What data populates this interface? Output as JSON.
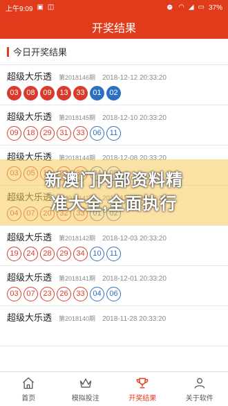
{
  "status_bar": {
    "time": "上午9:09",
    "battery": "37%"
  },
  "header": {
    "title": "开奖结果"
  },
  "section": {
    "title": "今日开奖结果"
  },
  "draws": [
    {
      "name": "超级大乐透",
      "issue": "第2018146期",
      "time": "2018-12-12 20:33:20",
      "red": [
        "03",
        "08",
        "09",
        "13",
        "33"
      ],
      "blue": [
        "01",
        "02"
      ],
      "style": "solid"
    },
    {
      "name": "超级大乐透",
      "issue": "第2018145期",
      "time": "2018-12-10 20:33:20",
      "red": [
        "09",
        "18",
        "29",
        "31",
        "33"
      ],
      "blue": [
        "06",
        "11"
      ],
      "style": "outline"
    },
    {
      "name": "超级大乐透",
      "issue": "第2018144期",
      "time": "2018-12-08 20:33:20",
      "red": [
        "03",
        "05",
        "19",
        "22",
        "31"
      ],
      "blue": [
        "04",
        "08"
      ],
      "style": "outline"
    },
    {
      "name": "超级大乐透",
      "issue": "第2018143期",
      "time": "2018-12-05 20:33:20",
      "red": [
        "04",
        "07",
        "20",
        "32",
        "33"
      ],
      "blue": [
        "01",
        "02"
      ],
      "style": "outline"
    },
    {
      "name": "超级大乐透",
      "issue": "第2018142期",
      "time": "2018-12-03 20:33:20",
      "red": [
        "19",
        "24",
        "28",
        "29",
        "34"
      ],
      "blue": [
        "10",
        "11"
      ],
      "style": "outline"
    },
    {
      "name": "超级大乐透",
      "issue": "第2018141期",
      "time": "2018-12-01 20:33:20",
      "red": [
        "03",
        "07",
        "23",
        "26",
        "33"
      ],
      "blue": [
        "04",
        "06"
      ],
      "style": "outline"
    },
    {
      "name": "超级大乐透",
      "issue": "第2018140期",
      "time": "2018-11-28 20:33:20",
      "red": [],
      "blue": [],
      "style": "outline"
    }
  ],
  "overlay": {
    "line1": "新澳门内部资料精",
    "line2": "准大全,全面执行"
  },
  "tabs": [
    {
      "label": "首页",
      "icon": "home-icon"
    },
    {
      "label": "模拟投注",
      "icon": "crown-icon"
    },
    {
      "label": "开奖结果",
      "icon": "trophy-icon",
      "active": true
    },
    {
      "label": "关于软件",
      "icon": "user-icon"
    }
  ],
  "colors": {
    "accent": "#e03c1c",
    "red_ball": "#d93a2b",
    "blue_ball": "#2a6fc1"
  }
}
